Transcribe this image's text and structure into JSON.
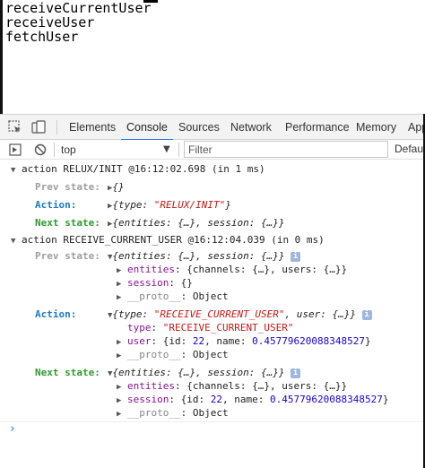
{
  "page": {
    "lines": [
      "receiveCurrentUser",
      "receiveUser",
      "fetchUser"
    ]
  },
  "devtools": {
    "tabs": [
      "Elements",
      "Console",
      "Sources",
      "Network",
      "Performance",
      "Memory",
      "App"
    ],
    "active_tab": "Console",
    "toolbar": {
      "context": "top",
      "filter_placeholder": "Filter",
      "levels": "Default"
    }
  },
  "console": {
    "group1": {
      "header": "action RELUX/INIT @16:12:02.698 (in 1 ms)",
      "prev_label": "Prev state:",
      "prev_value": "{}",
      "action_label": "Action:",
      "action_value_pre": "{type: ",
      "action_value_str": "\"RELUX/INIT\"",
      "action_value_post": "}",
      "next_label": "Next state:",
      "next_value": "{entities: {…}, session: {…}}"
    },
    "group2": {
      "header": "action RECEIVE_CURRENT_USER @16:12:04.039 (in 0 ms)",
      "prev_label": "Prev state:",
      "prev_value": "{entities: {…}, session: {…}}",
      "prev_entities_key": "entities",
      "prev_entities_val": ": {channels: {…}, users: {…}}",
      "prev_session_key": "session",
      "prev_session_val": ": {}",
      "prev_proto_key": "__proto__",
      "prev_proto_val": ": Object",
      "action_label": "Action:",
      "action_value_pre": "{type: ",
      "action_value_str": "\"RECEIVE_CURRENT_USER\"",
      "action_value_post": ", user: {…}}",
      "action_type_key": "type",
      "action_type_val": "\"RECEIVE_CURRENT_USER\"",
      "action_user_key": "user",
      "action_user_pre": ": {id: ",
      "action_user_id": "22",
      "action_user_mid": ", name: ",
      "action_user_name": "0.45779620088348527",
      "action_user_post": "}",
      "action_proto_key": "__proto__",
      "action_proto_val": ": Object",
      "next_label": "Next state:",
      "next_value": "{entities: {…}, session: {…}}",
      "next_entities_key": "entities",
      "next_entities_val": ": {channels: {…}, users: {…}}",
      "next_session_key": "session",
      "next_session_pre": ": {id: ",
      "next_session_id": "22",
      "next_session_mid": ", name: ",
      "next_session_name": "0.45779620088348527",
      "next_session_post": "}",
      "next_proto_key": "__proto__",
      "next_proto_val": ": Object"
    },
    "info_badge": "i",
    "prompt_symbol": "›"
  }
}
